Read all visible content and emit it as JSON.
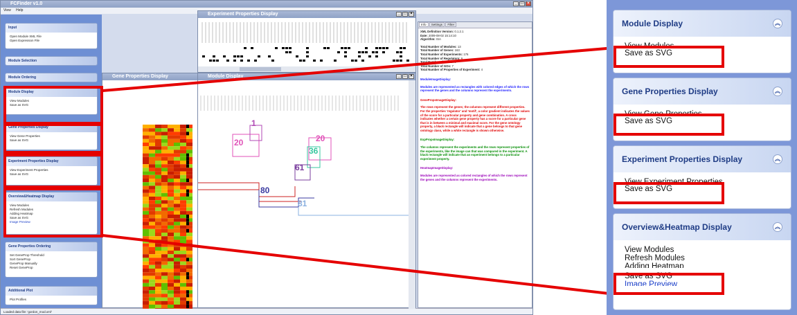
{
  "app": {
    "title": "FCFinder v1.0",
    "menu": [
      "View",
      "Help"
    ],
    "status": "Loaded data file: 'gordon_mod.xml'"
  },
  "sidebar": {
    "panels": [
      {
        "title": "Input",
        "items": [
          "Open Module XML File",
          "Open Expression File"
        ]
      },
      {
        "title": "Module Selection",
        "items": []
      },
      {
        "title": "Module Ordering",
        "items": []
      },
      {
        "title": "Module Display",
        "items": [
          "View Modules",
          "Save as SVG"
        ]
      },
      {
        "title": "Gene Properties Display",
        "items": [
          "View Gene Properties",
          "Save as SVG"
        ]
      },
      {
        "title": "Experiment Properties Display",
        "items": [
          "View Experiment Properties",
          "Save as SVG"
        ]
      },
      {
        "title": "Overview&Heatmap Display",
        "items": [
          "View Modules",
          "Refresh Modules",
          "Adding Heatmap",
          "Save as SVG",
          "Image Preview"
        ]
      },
      {
        "title": "Gene Properties Ordering",
        "items": [
          "Set GeneProp Threshold",
          "Sort GeneProp",
          "GeneProp Manually",
          "Reset GeneProp"
        ]
      },
      {
        "title": "Additional Plot",
        "items": [
          "Plot Profiles"
        ]
      }
    ]
  },
  "windows": {
    "experiment_props": {
      "title": "Experiment Properties Display"
    },
    "gene_props": {
      "title": "Gene Properties Display"
    },
    "module_display": {
      "title": "Module Display"
    }
  },
  "module_labels": [
    "20",
    "1",
    "20",
    "36",
    "61",
    "80",
    "81"
  ],
  "info": {
    "tabs": [
      "Info",
      "Settings",
      "Filter"
    ],
    "lines": [
      {
        "label": "XML Definition Version:",
        "value": "0.1.2.1"
      },
      {
        "label": "Date:",
        "value": "2009-08-02 15:14:10"
      },
      {
        "label": "Algorithm:",
        "value": "ISA"
      },
      {
        "label": "Total Number of Modules:",
        "value": "13"
      },
      {
        "label": "Total Number of Genes:",
        "value": "163"
      },
      {
        "label": "Total Number of Experiments:",
        "value": "176"
      },
      {
        "label": "Total Number of Regulators:",
        "value": "6"
      },
      {
        "label": "Total Number of Motifs:",
        "value": "6"
      },
      {
        "label": "Total Number of GOs:",
        "value": "7"
      },
      {
        "label": "Total Number of Properties of Experiment:",
        "value": "4"
      }
    ],
    "sections": [
      {
        "heading": "ModuleImageDisplay:",
        "color": "#1a1aff",
        "body": "Modules are represented as rectangles with colored edges of which the rows represent the genes and the columns represent the experiments."
      },
      {
        "heading": "GenePropsImageDisplay:",
        "color": "#e00000",
        "body": "The rows represent the genes; the columns represent different properties. For the properties 'regulator' and 'motif', a color gradient indicates the values of the score for a particular property and gene combination. A cross indicates whether a certain gene property has a score for a particular gene that is in between a minimal and maximal score. For the gene ontology property, a black rectangle will indicate that a gene belongs to that gene ontology class, while a white rectangle is shown otherwise."
      },
      {
        "heading": "ExpPropsImageDisplay:",
        "color": "#008c00",
        "body": "The columns represent the experiments and the rows represent properties of the experiments, like the image can that was compared in the experiment. A black rectangle will indicate that an experiment belongs to a particular experiment property."
      },
      {
        "heading": "HeatmapImageDisplay:",
        "color": "#9a00b8",
        "body": "Modules are represented as colored rectangles of which the rows represent the genes and the columns represent the experiments."
      }
    ]
  },
  "zoom_panels": [
    {
      "title": "Module Display",
      "items": [
        "View Modules",
        "Save as SVG"
      ],
      "highlight": "Save as SVG"
    },
    {
      "title": "Gene Properties Display",
      "items": [
        "View Gene Properties",
        "Save as SVG"
      ],
      "highlight": "Save as SVG"
    },
    {
      "title": "Experiment Properties Display",
      "items": [
        "View Experiment Properties",
        "Save as SVG"
      ],
      "highlight": "Save as SVG"
    },
    {
      "title": "Overview&Heatmap Display",
      "items": [
        "View Modules",
        "Refresh Modules",
        "Adding Heatmap",
        "Save as SVG",
        "Image Preview"
      ],
      "highlight": "Save as SVG"
    }
  ],
  "colors": {
    "highlight": "#e50000",
    "panel_title": "#1f3c85",
    "titlebar": "#8fa2c6"
  }
}
